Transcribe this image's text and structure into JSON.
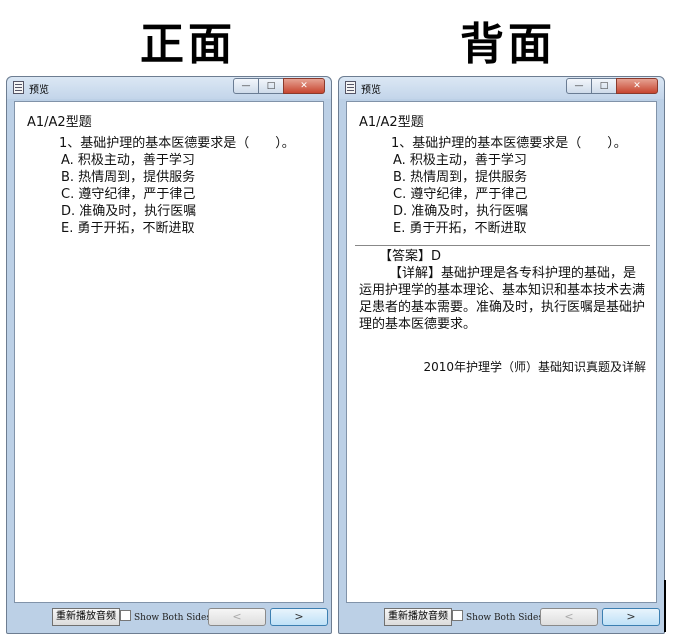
{
  "headings": {
    "front": "正面",
    "back": "背面"
  },
  "window": {
    "title": "预览",
    "buttons": {
      "minimize": "—",
      "maximize": "□",
      "close": "✕"
    }
  },
  "card": {
    "section": "A1/A2型题",
    "question": "1、基础护理的基本医德要求是（　　）。",
    "options": [
      "A. 积极主动，善于学习",
      "B. 热情周到，提供服务",
      "C. 遵守纪律，严于律己",
      "D. 准确及时，执行医嘱",
      "E. 勇于开拓，不断进取"
    ],
    "answer": "【答案】D",
    "explanation": "【详解】基础护理是各专科护理的基础，是运用护理学的基本理论、基本知识和基本技术去满足患者的基本需要。准确及时，执行医嘱是基础护理的基本医德要求。",
    "source": "2010年护理学（师）基础知识真题及详解"
  },
  "bottom": {
    "replay_label": "重新播放音频",
    "show_both_sides_label": "Show Both Sides",
    "show_both_sides_checked": false,
    "prev_label": "<",
    "next_label": ">"
  }
}
